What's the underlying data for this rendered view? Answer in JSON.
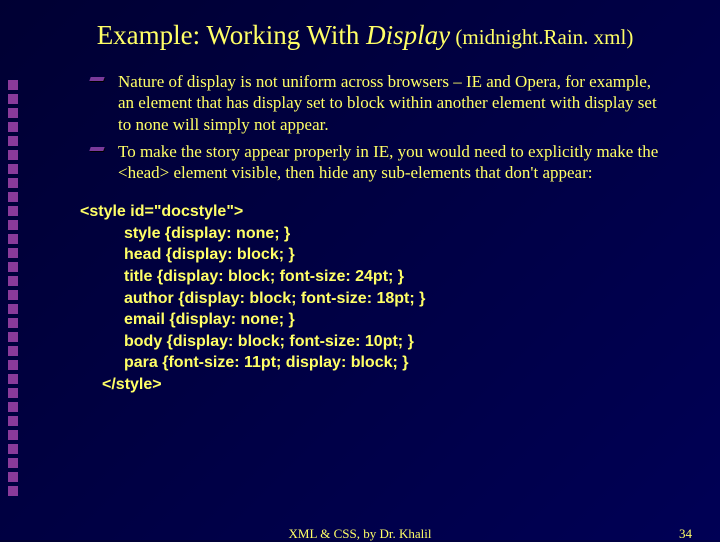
{
  "title": {
    "prefix": "Example: Working With ",
    "italic": "Display",
    "suffix_small": " (midnight.Rain. xml)"
  },
  "bullets": [
    "Nature of display is not uniform across browsers – IE and Opera, for example, an element that has display set to block within another element with display set to none will simply not appear.",
    "To make the story appear properly in IE, you would need to explicitly make the <head> element visible, then hide any sub-elements that don't appear:"
  ],
  "code": {
    "l0": "<style id=\"docstyle\">",
    "l1": "style {display: none; }",
    "l2": "head {display: block; }",
    "l3": "title {display: block; font-size: 24pt; }",
    "l4": "author {display: block; font-size: 18pt; }",
    "l5": "email {display: none; }",
    "l6": "body {display: block; font-size: 10pt; }",
    "l7": "para {font-size: 11pt; display: block; }",
    "l8": "</style>"
  },
  "footer": {
    "center": "XML & CSS, by Dr. Khalil",
    "page": "34"
  }
}
